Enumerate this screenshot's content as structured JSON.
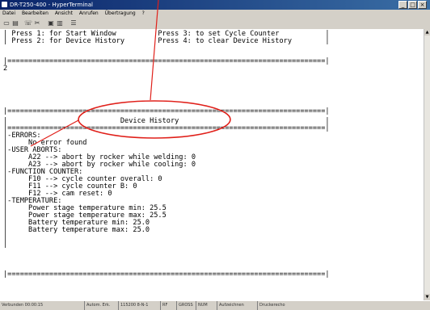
{
  "window": {
    "title": "DR-T250-400 - HyperTerminal",
    "controls": [
      "_",
      "□",
      "×"
    ]
  },
  "menu": [
    "Datei",
    "Bearbeiten",
    "Ansicht",
    "Anrufen",
    "Übertragung",
    "?"
  ],
  "toolbar": {
    "icons": [
      "new-icon",
      "open-icon",
      "phone-icon",
      "disconnect-icon",
      "send-icon",
      "receive-icon",
      "properties-icon"
    ]
  },
  "terminal": {
    "menu_line1": "| Press 1: for Start Window          Press 3: to set Cycle Counter           |",
    "menu_line2": "| Press 2: for Device History        Press 4: to clear Device History        |",
    "sep1": "|============================================================================|",
    "input": "2",
    "sep2": "|============================================================================|",
    "header": "|                           Device History                                   |",
    "sep3": "|============================================================================|",
    "lines": [
      "|-ERRORS:",
      "|     No error found",
      "|-USER ABORTS:",
      "|     A22 --> abort by rocker while welding: 0",
      "|     A23 --> abort by rocker while cooling: 0",
      "|-FUNCTION COUNTER:",
      "|     F10 --> cycle counter overall: 0",
      "|     F11 --> cycle counter B: 0",
      "|     F12 --> cam reset: 0",
      "|-TEMPERATURE:",
      "|     Power stage temperature min: 25.5",
      "|     Power stage temperature max: 25.5",
      "|     Battery temperature min: 25.0",
      "|     Battery temperature max: 25.0",
      "|",
      "|"
    ],
    "sep4": "|============================================================================|"
  },
  "status": {
    "connected": "Verbunden 00:00:15",
    "detect": "Autom. Erk.",
    "params": "115200 8-N-1",
    "rf": "RF",
    "caps": "GROSS",
    "num": "NUM",
    "record": "Aufzeichnen",
    "echo": "Druckerecho"
  },
  "annotation": {
    "color": "#e0201a"
  }
}
